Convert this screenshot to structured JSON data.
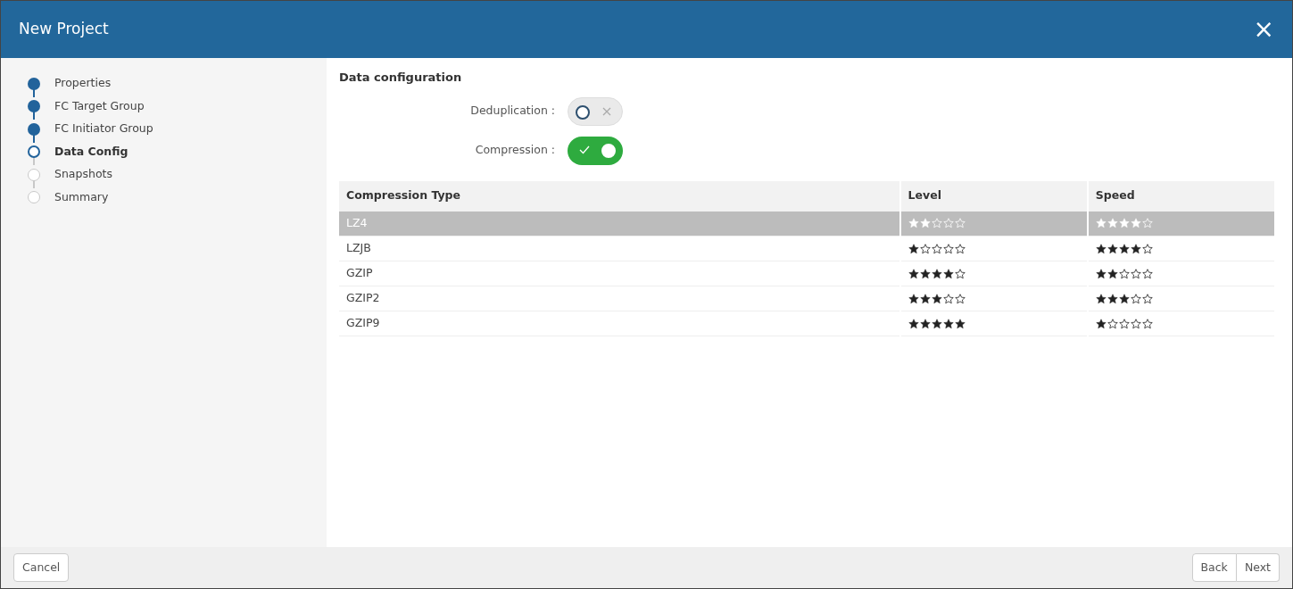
{
  "window": {
    "title": "New Project",
    "close": "×"
  },
  "steps": [
    {
      "label": "Properties",
      "completed": true,
      "selected": false
    },
    {
      "label": "FC Target Group",
      "completed": true,
      "selected": false
    },
    {
      "label": "FC Initiator Group",
      "completed": true,
      "selected": false
    },
    {
      "label": "Data Config",
      "completed": false,
      "selected": true
    },
    {
      "label": "Snapshots",
      "completed": false,
      "selected": false
    },
    {
      "label": "Summary",
      "completed": false,
      "selected": false
    }
  ],
  "section_title": "Data configuration",
  "toggles": [
    {
      "label": "Deduplication :",
      "on": false
    },
    {
      "label": "Compression :",
      "on": true
    }
  ],
  "table": {
    "columns": [
      "Compression Type",
      "Level",
      "Speed"
    ],
    "rows": [
      {
        "name": "LZ4",
        "level_rating": {
          "stars": 2
        },
        "speed_rating": {
          "stars": 4
        },
        "selected": true
      },
      {
        "name": "LZJB",
        "level_rating": {
          "stars": 1
        },
        "speed_rating": {
          "stars": 4
        },
        "selected": false
      },
      {
        "name": "GZIP",
        "level_rating": {
          "stars": 4
        },
        "speed_rating": {
          "stars": 2
        },
        "selected": false
      },
      {
        "name": "GZIP2",
        "level_rating": {
          "stars": 3
        },
        "speed_rating": {
          "stars": 3
        },
        "selected": false
      },
      {
        "name": "GZIP9",
        "level_rating": {
          "stars": 5
        },
        "speed_rating": {
          "stars": 1
        },
        "selected": false
      }
    ]
  },
  "footer": {
    "cancel": "Cancel",
    "back": "Back",
    "next": "Next"
  }
}
